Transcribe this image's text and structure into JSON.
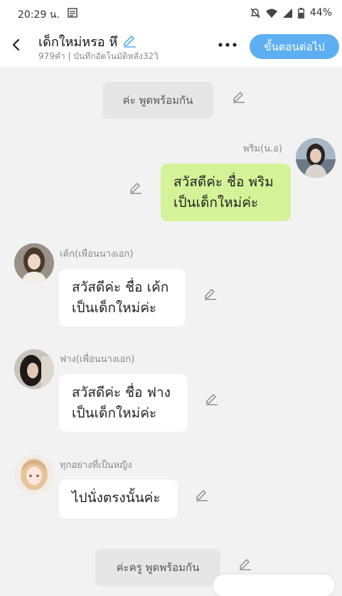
{
  "status": {
    "time": "20:29 น.",
    "battery": "44%"
  },
  "header": {
    "title": "เด็กใหม่หรอ หึ",
    "subtitle": "979คำ | บันทึกอัตโนมัติหลัง32วิ",
    "next_label": "ขั้นตอนต่อไป"
  },
  "messages": [
    {
      "type": "narration",
      "text": "ค่ะ พูดพร้อมกัน"
    },
    {
      "type": "right",
      "name": "พริม(น.อ)",
      "lines": [
        "สวัสดีค่ะ ชื่อ พริม",
        "เป็นเด็กใหม่ค่ะ"
      ]
    },
    {
      "type": "left",
      "name": "เค้ก(เพื่อนนางเอก)",
      "lines": [
        "สวัสดีค่ะ ชื่อ เค้ก",
        "เป็นเด็กใหม่ค่ะ"
      ]
    },
    {
      "type": "left",
      "name": "ฟาง(เพื่อนนางเอก)",
      "lines": [
        "สวัสดีค่ะ ชื่อ ฟาง",
        "เป็นเด็กใหม่ค่ะ"
      ]
    },
    {
      "type": "left",
      "name": "ทุกอย่างที่เป็นหญิง",
      "lines": [
        "ไปนั่งตรงนั้นค่ะ"
      ]
    },
    {
      "type": "narration",
      "text": "ค่ะครู พูดพร้อมกัน"
    }
  ],
  "colors": {
    "accent": "#5eaef2",
    "right_bubble": "#d4f297",
    "background": "#f2f2f2"
  }
}
